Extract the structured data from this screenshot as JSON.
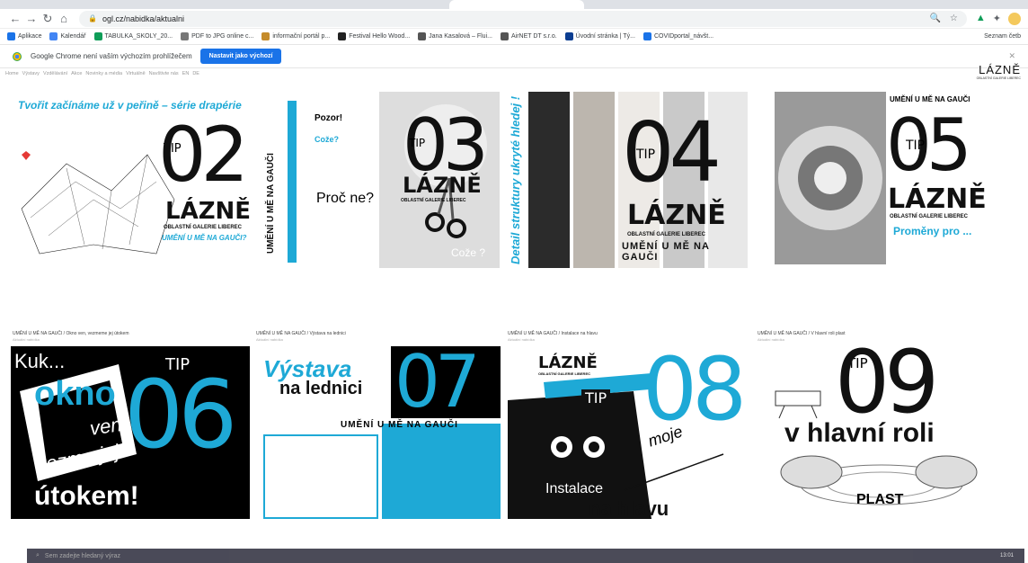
{
  "browser": {
    "address": "ogl.cz/nabidka/aktualni",
    "bookmarks": [
      {
        "label": "Aplikace",
        "color": "#1a73e8"
      },
      {
        "label": "Kalendář",
        "color": "#4285f4"
      },
      {
        "label": "TABULKA_SKOLY_20...",
        "color": "#0f9d58"
      },
      {
        "label": "PDF to JPG online c...",
        "color": "#777777"
      },
      {
        "label": "informační portál p...",
        "color": "#c58b2a"
      },
      {
        "label": "Festival Hello Wood...",
        "color": "#222222"
      },
      {
        "label": "Jana Kasalová – Flui...",
        "color": "#555555"
      },
      {
        "label": "AirNET DT s.r.o.",
        "color": "#555555"
      },
      {
        "label": "Úvodní stránka | Tý...",
        "color": "#0b3d91"
      },
      {
        "label": "COVIDportal_návšt...",
        "color": "#1a73e8"
      }
    ],
    "reading_list": "Seznam četb",
    "infobar_text": "Google Chrome není vaším výchozím prohlížečem",
    "infobar_button": "Nastavit jako výchozí"
  },
  "site": {
    "nav": [
      "Home",
      "Výstavy",
      "Vzdělávání",
      "Akce",
      "Novinky a média",
      "Virtuálně",
      "Navštivte nás",
      "EN",
      "DE"
    ],
    "logo": "LÁZNĚ",
    "logo_sub": "OBLASTNÍ GALERIE LIBEREC"
  },
  "tiles": {
    "t02": {
      "title": "Tvořit začínáme už v peřině – série drapérie",
      "tip": "TIP",
      "num": "02",
      "lazne": "LÁZNĚ",
      "sub1": "OBLASTNÍ GALERIE LIBEREC",
      "sub2": "UMĚNÍ U MĚ NA GAUČI?"
    },
    "t03": {
      "q1": "Pozor!",
      "q2": "Cože?",
      "q3": "Proč ne?",
      "side": "UMĚNÍ U MĚ NA GAUČI",
      "tip": "TIP",
      "num": "03",
      "lazne": "LÁZNĚ",
      "sub1": "OBLASTNÍ GALERIE LIBEREC",
      "coze": "Cože ?"
    },
    "t04": {
      "side": "Detail struktury ukryté hledej !",
      "tip": "TIP",
      "num": "04",
      "lazne": "LÁZNĚ",
      "sub1": "OBLASTNÍ GALERIE LIBEREC",
      "sub2": "UMĚNÍ U MĚ NA GAUČI"
    },
    "t05": {
      "top": "UMĚNÍ U MĚ NA GAUČI",
      "tip": "TIP",
      "num": "05",
      "lazne": "LÁZNĚ",
      "sub1": "OBLASTNÍ GALERIE LIBEREC",
      "sub2": "Proměny pro ..."
    },
    "t06": {
      "caption": "UMĚNÍ U MĚ NA GAUČI / Okno ven, vezmeme jej útokem",
      "sub": "Aktuální nabídka",
      "kuk": "Kuk...",
      "okno": "okno",
      "ven": "ven,",
      "vezme": "vezme jej",
      "utokem": "útokem!",
      "tip": "TIP",
      "num": "06"
    },
    "t07": {
      "caption": "UMĚNÍ U MĚ NA GAUČI / Výstava na lednici",
      "sub": "Aktuální nabídka",
      "vystava": "Výstava",
      "lednici": "na lednici",
      "tip": "TIP",
      "num": "07",
      "umeni": "UMĚNÍ U MĚ NA GAUČI"
    },
    "t08": {
      "caption": "UMĚNÍ U MĚ NA GAUČI / Instalace na hlavu",
      "sub": "Aktuální nabídka",
      "lazne": "LÁZNĚ",
      "sub1": "OBLASTNÍ GALERIE LIBEREC",
      "tip": "TIP",
      "num": "08",
      "moje": "moje",
      "instalace": "Instalace",
      "nahlavu": "na hlavu"
    },
    "t09": {
      "caption": "UMĚNÍ U MĚ NA GAUČI / V hlavní roli plast",
      "sub": "Aktuální nabídka",
      "tip": "TIP",
      "num": "09",
      "roli": "v hlavní roli",
      "plast": "PLAST"
    }
  },
  "taskbar": {
    "search": "Sem zadejte hledaný výraz",
    "time": "13:01"
  },
  "colors": {
    "accent": "#1ea9d6",
    "chrome_blue": "#1a73e8"
  }
}
